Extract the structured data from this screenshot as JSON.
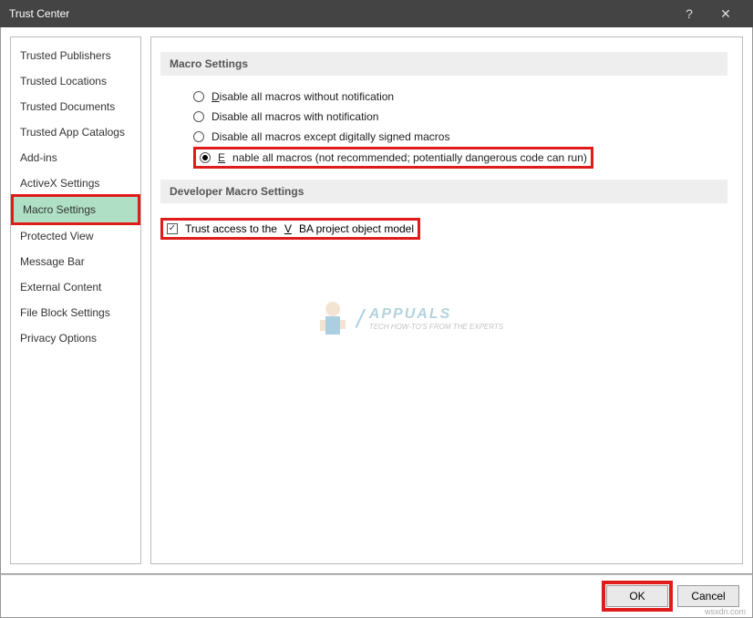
{
  "titlebar": {
    "title": "Trust Center",
    "help": "?",
    "close": "✕"
  },
  "sidebar": {
    "items": [
      {
        "label": "Trusted Publishers"
      },
      {
        "label": "Trusted Locations"
      },
      {
        "label": "Trusted Documents"
      },
      {
        "label": "Trusted App Catalogs"
      },
      {
        "label": "Add-ins"
      },
      {
        "label": "ActiveX Settings"
      },
      {
        "label": "Macro Settings"
      },
      {
        "label": "Protected View"
      },
      {
        "label": "Message Bar"
      },
      {
        "label": "External Content"
      },
      {
        "label": "File Block Settings"
      },
      {
        "label": "Privacy Options"
      }
    ]
  },
  "main": {
    "macro_header": "Macro Settings",
    "radios": {
      "r0": "isable all macros without notification",
      "r1": "Disable all macros with notification",
      "r2": "Disable all macros except digitally signed macros",
      "r3_a": "nable all macros (not recommended; potentially dangerous code can run)"
    },
    "dev_header": "Developer Macro Settings",
    "trust_a": "Trust access to the ",
    "trust_b": "BA project object model"
  },
  "footer": {
    "ok": "OK",
    "cancel": "Cancel"
  },
  "watermark": {
    "brand": "APPUALS",
    "sub": "TECH HOW-TO'S FROM THE EXPERTS"
  },
  "attribution": "wsxdn.com"
}
